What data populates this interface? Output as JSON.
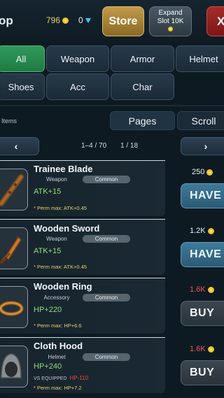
{
  "header": {
    "title": "op",
    "gold": "796",
    "gems": "0",
    "store_label": "Store",
    "expand_line1": "Expand",
    "expand_line2": "Slot 10K",
    "close_label": "X"
  },
  "filters": [
    {
      "label": "All",
      "active": true
    },
    {
      "label": "Weapon"
    },
    {
      "label": "Armor"
    },
    {
      "label": "Helmet"
    },
    {
      "label": "Shoes"
    },
    {
      "label": "Acc"
    },
    {
      "label": "Char"
    }
  ],
  "list_header": {
    "items_label": "Items",
    "tabs": [
      "Pages",
      "Scroll"
    ]
  },
  "pager": {
    "prev": "‹",
    "next": "›",
    "range": "1–4 / 70",
    "page": "1 / 18"
  },
  "items": [
    {
      "name": "Trainee Blade",
      "type": "Weapon",
      "rarity": "Common",
      "stat": "ATK+15",
      "perm": "* Perm max: ATK+0.45",
      "price": "250",
      "price_color": "#e8eef2",
      "action": "HAVE",
      "icon": "club-icon"
    },
    {
      "name": "Wooden Sword",
      "type": "Weapon",
      "rarity": "Common",
      "stat": "ATK+15",
      "perm": "* Perm max: ATK+0.45",
      "price": "1.2K",
      "price_color": "#e8eef2",
      "action": "HAVE",
      "icon": "sword-icon"
    },
    {
      "name": "Wooden Ring",
      "type": "Accessory",
      "rarity": "Common",
      "stat": "HP+220",
      "perm": "* Perm max: HP+6.6",
      "price": "1.6K",
      "price_color": "#ef5555",
      "action": "BUY",
      "icon": "ring-icon"
    },
    {
      "name": "Cloth Hood",
      "type": "Helmet",
      "rarity": "Common",
      "stat": "HP+240",
      "vs_label": "VS EQUIPPED",
      "vs_value": "HP-110",
      "perm": "* Perm max: HP+7.2",
      "price": "1.6K",
      "price_color": "#ef5555",
      "action": "BUY",
      "icon": "hood-icon"
    }
  ]
}
